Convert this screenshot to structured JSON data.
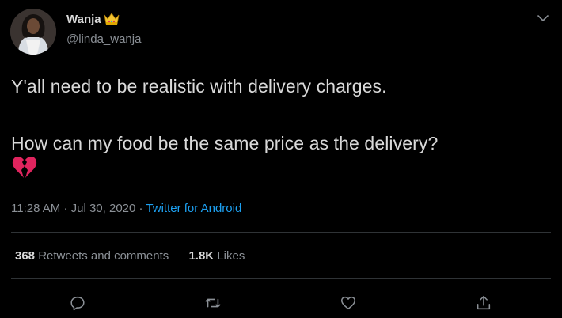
{
  "user": {
    "display_name": "Wanja",
    "handle": "@linda_wanja",
    "badge_icon": "crown-emoji-icon"
  },
  "tweet": {
    "line1": "Y'all need to be realistic with delivery charges.",
    "line2": "How can my food be the same price as the delivery?",
    "emoji_icon": "broken-heart-icon"
  },
  "meta": {
    "time": "11:28 AM",
    "date": "Jul 30, 2020",
    "source": "Twitter for Android",
    "sep": "·"
  },
  "stats": {
    "retweets_count": "368",
    "retweets_label": "Retweets and comments",
    "likes_count": "1.8K",
    "likes_label": "Likes"
  },
  "actions": [
    "reply-icon",
    "retweet-icon",
    "like-icon",
    "share-icon"
  ],
  "colors": {
    "background": "#000000",
    "text": "#d9d9d9",
    "muted": "#8b9096",
    "link": "#1da1f2",
    "divider": "#2f3336",
    "heart": "#e0245e"
  }
}
